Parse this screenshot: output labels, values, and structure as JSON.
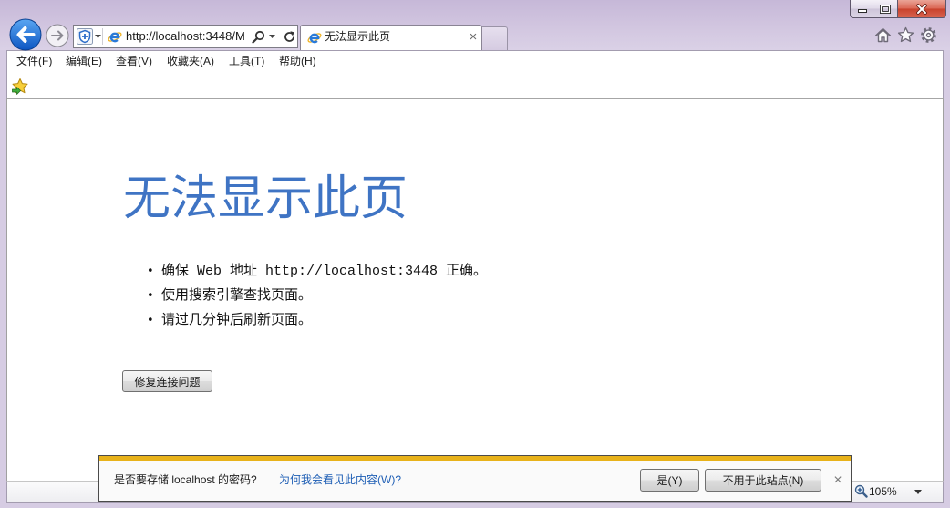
{
  "colors": {
    "window_frame": "#d6cce3",
    "back_button": "#1f6fd6",
    "heading": "#3f74c4",
    "link": "#1f5fb5",
    "notification_accent": "#e8b21a",
    "close_button": "#c8412c"
  },
  "window_controls": {
    "icons": [
      "minimize-icon",
      "maximize-icon",
      "close-icon"
    ]
  },
  "navigation": {
    "icons": [
      "back-arrow-icon",
      "forward-arrow-icon"
    ],
    "address": {
      "url": "http://localhost:3448/M",
      "icons": [
        "compatibility-shield-icon",
        "ie-page-icon",
        "search-icon",
        "chevron-down-icon",
        "refresh-icon"
      ]
    },
    "tabs": [
      {
        "title": "无法显示此页",
        "close": "×",
        "active": true
      }
    ],
    "toolbar_icons": [
      "home-icon",
      "favorites-star-icon",
      "gear-icon"
    ]
  },
  "menu": {
    "items": [
      {
        "label": "文件(F)"
      },
      {
        "label": "编辑(E)"
      },
      {
        "label": "查看(V)"
      },
      {
        "label": "收藏夹(A)"
      },
      {
        "label": "工具(T)"
      },
      {
        "label": "帮助(H)"
      }
    ]
  },
  "favorites_bar": {
    "icons": [
      "add-to-favorites-bar-icon"
    ]
  },
  "page": {
    "heading": "无法显示此页",
    "bullets": [
      "确保 Web 地址 http://localhost:3448 正确。",
      "使用搜索引擎查找页面。",
      "请过几分钟后刷新页面。"
    ],
    "fix_button": "修复连接问题"
  },
  "notification": {
    "message": "是否要存储 localhost 的密码?",
    "help_link": "为何我会看见此内容(W)?",
    "yes_button": "是(Y)",
    "no_button": "不用于此站点(N)",
    "close": "×"
  },
  "status_bar": {
    "zoom": "105%",
    "icons": [
      "zoom-icon",
      "chevron-down-icon"
    ]
  }
}
